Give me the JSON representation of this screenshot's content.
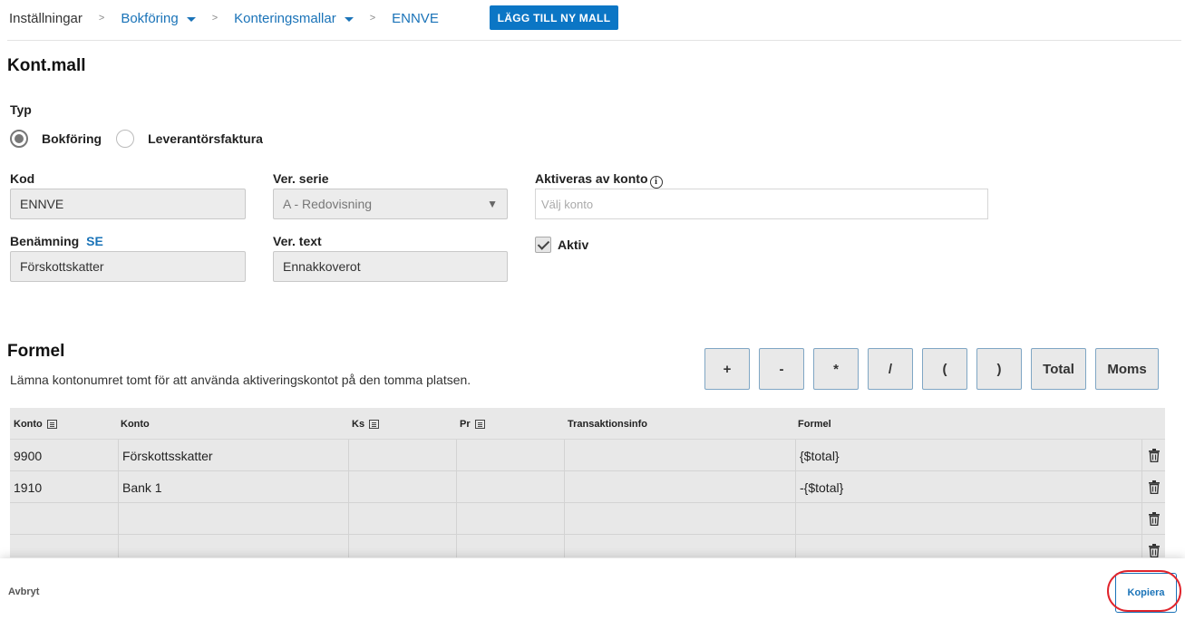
{
  "breadcrumb": {
    "root": "Inställningar",
    "level1": "Bokföring",
    "level2": "Konteringsmallar",
    "current": "ENNVE",
    "separator": ">"
  },
  "add_button": "LÄGG TILL NY MALL",
  "page_title": "Kont.mall",
  "type": {
    "label": "Typ",
    "options": [
      {
        "label": "Bokföring",
        "selected": true
      },
      {
        "label": "Leverantörsfaktura",
        "selected": false
      }
    ]
  },
  "fields": {
    "kod": {
      "label": "Kod",
      "value": "ENNVE"
    },
    "ver_serie": {
      "label": "Ver. serie",
      "value": "A - Redovisning"
    },
    "aktiveras": {
      "label": "Aktiveras av konto",
      "placeholder": "Välj konto"
    },
    "benamning": {
      "label": "Benämning",
      "lang": "SE",
      "value": "Förskottskatter"
    },
    "ver_text": {
      "label": "Ver. text",
      "value": "Ennakkoverot"
    },
    "aktiv": {
      "label": "Aktiv",
      "checked": true
    }
  },
  "formula": {
    "title": "Formel",
    "hint": "Lämna kontonumret tomt för att använda aktiveringskontot på den tomma platsen.",
    "operators": [
      "+",
      "-",
      "*",
      "/",
      "(",
      ")",
      "Total",
      "Moms"
    ]
  },
  "table": {
    "headers": {
      "konto_nr": "Konto",
      "konto": "Konto",
      "ks": "Ks",
      "pr": "Pr",
      "transinfo": "Transaktionsinfo",
      "formel": "Formel"
    },
    "rows": [
      {
        "konto_nr": "9900",
        "konto": "Förskottsskatter",
        "ks": "",
        "pr": "",
        "transinfo": "",
        "formel": "{$total}"
      },
      {
        "konto_nr": "1910",
        "konto": "Bank 1",
        "ks": "",
        "pr": "",
        "transinfo": "",
        "formel": "-{$total}"
      },
      {
        "konto_nr": "",
        "konto": "",
        "ks": "",
        "pr": "",
        "transinfo": "",
        "formel": ""
      },
      {
        "konto_nr": "",
        "konto": "",
        "ks": "",
        "pr": "",
        "transinfo": "",
        "formel": ""
      }
    ]
  },
  "footer": {
    "cancel": "Avbryt",
    "copy": "Kopiera"
  },
  "colors": {
    "primary": "#0b76c5",
    "link": "#1a73b8",
    "highlight": "#e0242c"
  }
}
